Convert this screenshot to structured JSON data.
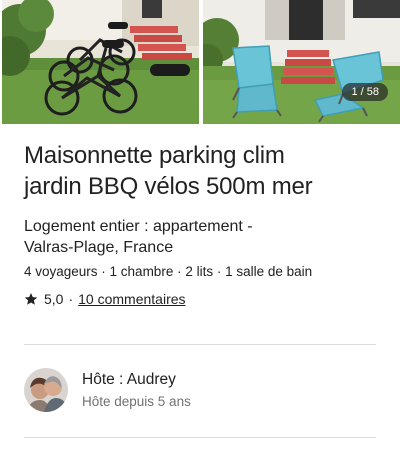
{
  "gallery": {
    "counter": "1 / 58",
    "photos": [
      {
        "icon": "photo-bicycles-garden"
      },
      {
        "icon": "photo-deck-chairs-garden"
      }
    ]
  },
  "listing": {
    "title_line1": "Maisonnette parking clim",
    "title_line2": "jardin BBQ vélos 500m mer",
    "type_line1": "Logement entier : appartement -",
    "type_line2": "Valras-Plage, France",
    "details": "4 voyageurs · 1 chambre · 2 lits · 1 salle de bain",
    "rating": "5,0",
    "separator": "·",
    "reviews": "10 commentaires"
  },
  "host": {
    "name": "Hôte : Audrey",
    "since": "Hôte depuis 5 ans"
  },
  "colors": {
    "text": "#222222",
    "secondary_text": "#717171",
    "divider": "#dddddd",
    "grass": "#5f8f3a",
    "steps": "#d4544f"
  }
}
